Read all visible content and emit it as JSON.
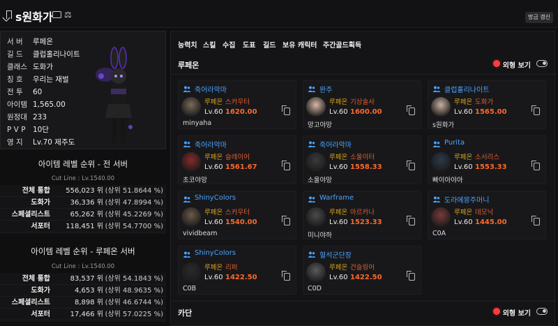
{
  "header": {
    "title": "s원화가",
    "refresh_label": "방금 갱신"
  },
  "profile": {
    "rows": [
      {
        "key": "서 버",
        "value": "루페온"
      },
      {
        "key": "길 드",
        "value": "클럽홀리나이트"
      },
      {
        "key": "클래스",
        "value": "도화가"
      },
      {
        "key": "칭 호",
        "value": "우리는 재벌"
      },
      {
        "key": "전 투",
        "value": "60"
      },
      {
        "key": "아이템",
        "value": "1,565.00"
      },
      {
        "key": "원정대",
        "value": "233"
      },
      {
        "key": "P V P",
        "value": "10단"
      },
      {
        "key": "영 지",
        "value": "Lv.70 제주도"
      }
    ]
  },
  "ranking_all": {
    "title": "아이템 레벨 순위 - 전 서버",
    "cutline": "Cut Line : Lv.1540.00",
    "rows": [
      {
        "name": "전체 통합",
        "rank": "556,023 위",
        "pct": "(상위 51.8644 %)"
      },
      {
        "name": "도화가",
        "rank": "36,336 위",
        "pct": "(상위 47.8994 %)"
      },
      {
        "name": "스페셜리스트",
        "rank": "65,262 위",
        "pct": "(상위 45.2269 %)"
      },
      {
        "name": "서포터",
        "rank": "118,451 위",
        "pct": "(상위 54.7700 %)"
      }
    ]
  },
  "ranking_server": {
    "title": "아이템 레벨 순위 - 루페온 서버",
    "cutline": "Cut Line : Lv.1540.00",
    "rows": [
      {
        "name": "전체 통합",
        "rank": "83,537 위",
        "pct": "(상위 54.1843 %)"
      },
      {
        "name": "도화가",
        "rank": "4,653 위",
        "pct": "(상위 48.9635 %)"
      },
      {
        "name": "스페셜리스트",
        "rank": "8,898 위",
        "pct": "(상위 46.6744 %)"
      },
      {
        "name": "서포터",
        "rank": "17,466 위",
        "pct": "(상위 57.0225 %)"
      }
    ]
  },
  "tabs": [
    "능력치",
    "스킬",
    "수집",
    "도표",
    "길드",
    "보유 캐릭터",
    "주간골드획득"
  ],
  "sections": [
    {
      "title": "루페온",
      "look_label": "외형 보기"
    },
    {
      "title": "카단",
      "look_label": "외형 보기"
    }
  ],
  "characters": [
    {
      "guild": "죽어라악마",
      "server": "루페온",
      "class": "스카우터",
      "lv": "Lv.60",
      "ilvl": "1620.00",
      "nick": "minyaha"
    },
    {
      "guild": "완주",
      "server": "루페온",
      "class": "기상술사",
      "lv": "Lv.60",
      "ilvl": "1600.00",
      "nick": "망고야망"
    },
    {
      "guild": "클럽홀리나이트",
      "server": "루페온",
      "class": "도화가",
      "lv": "Lv.60",
      "ilvl": "1565.00",
      "nick": "s원화가"
    },
    {
      "guild": "죽어라악마",
      "server": "루페온",
      "class": "슬레이어",
      "lv": "Lv.60",
      "ilvl": "1561.67",
      "nick": "초코야망"
    },
    {
      "guild": "죽어라악마",
      "server": "루페온",
      "class": "소울이터",
      "lv": "Lv.60",
      "ilvl": "1558.33",
      "nick": "소울야망"
    },
    {
      "guild": "Purita",
      "server": "루페온",
      "class": "소서리스",
      "lv": "Lv.60",
      "ilvl": "1553.33",
      "nick": "빠이아야아"
    },
    {
      "guild": "ShinyColors",
      "server": "루페온",
      "class": "스카우터",
      "lv": "Lv.60",
      "ilvl": "1540.00",
      "nick": "vividbeam"
    },
    {
      "guild": "Warframe",
      "server": "루페온",
      "class": "아르카나",
      "lv": "Lv.60",
      "ilvl": "1523.33",
      "nick": "미니야하"
    },
    {
      "guild": "도라에몽주머니",
      "server": "루페온",
      "class": "데모닉",
      "lv": "Lv.60",
      "ilvl": "1445.00",
      "nick": "C0A"
    },
    {
      "guild": "ShinyColors",
      "server": "루페온",
      "class": "리퍼",
      "lv": "Lv.60",
      "ilvl": "1422.50",
      "nick": "C0B"
    },
    {
      "guild": "혈석군단장",
      "server": "루페온",
      "class": "건슬링어",
      "lv": "Lv.60",
      "ilvl": "1422.50",
      "nick": "C0D"
    }
  ]
}
